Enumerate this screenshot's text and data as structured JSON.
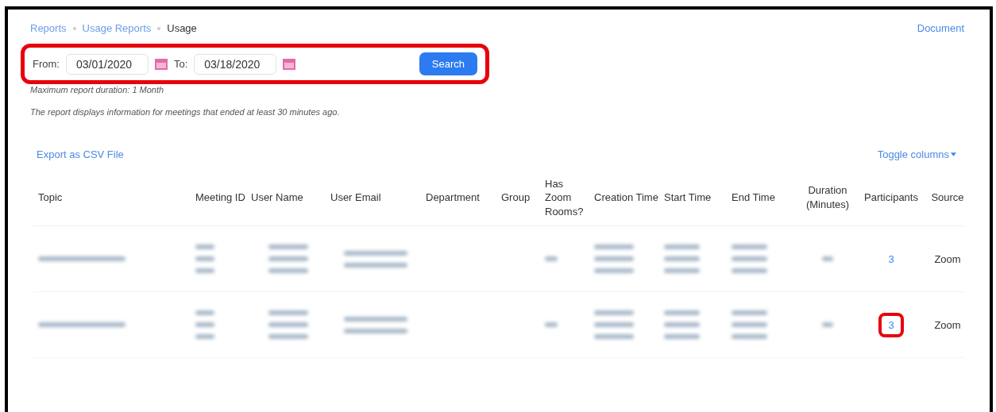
{
  "breadcrumb": [
    {
      "label": "Reports",
      "current": false
    },
    {
      "label": "Usage Reports",
      "current": false
    },
    {
      "label": "Usage",
      "current": true
    }
  ],
  "document_link": "Document",
  "filter": {
    "highlighted": true,
    "from_label": "From:",
    "from_value": "03/01/2020",
    "to_label": "To:",
    "to_value": "03/18/2020",
    "search_button": "Search"
  },
  "notes": [
    "Maximum report duration: 1 Month",
    "The report displays information for meetings that ended at least 30 minutes ago."
  ],
  "export_link": "Export as CSV File",
  "toggle_columns": "Toggle columns",
  "table": {
    "columns": [
      "Topic",
      "Meeting ID",
      "User Name",
      "User Email",
      "Department",
      "Group",
      "Has Zoom Rooms?",
      "Creation Time",
      "Start Time",
      "End Time",
      "Duration (Minutes)",
      "Participants",
      "Source"
    ],
    "rows": [
      {
        "cells": [
          {
            "kind": "blurred"
          },
          {
            "kind": "blurred"
          },
          {
            "kind": "blurred"
          },
          {
            "kind": "blurred"
          },
          {
            "kind": "blank"
          },
          {
            "kind": "blank"
          },
          {
            "kind": "blurred"
          },
          {
            "kind": "blurred"
          },
          {
            "kind": "blurred"
          },
          {
            "kind": "blurred"
          },
          {
            "kind": "blurred"
          },
          {
            "kind": "link",
            "text": "3",
            "highlighted": false
          },
          {
            "kind": "text",
            "text": "Zoom"
          }
        ]
      },
      {
        "cells": [
          {
            "kind": "blurred"
          },
          {
            "kind": "blurred"
          },
          {
            "kind": "blurred"
          },
          {
            "kind": "blurred"
          },
          {
            "kind": "blank"
          },
          {
            "kind": "blank"
          },
          {
            "kind": "blurred"
          },
          {
            "kind": "blurred"
          },
          {
            "kind": "blurred"
          },
          {
            "kind": "blurred"
          },
          {
            "kind": "blurred"
          },
          {
            "kind": "link",
            "text": "3",
            "highlighted": true
          },
          {
            "kind": "text",
            "text": "Zoom"
          }
        ]
      }
    ]
  }
}
